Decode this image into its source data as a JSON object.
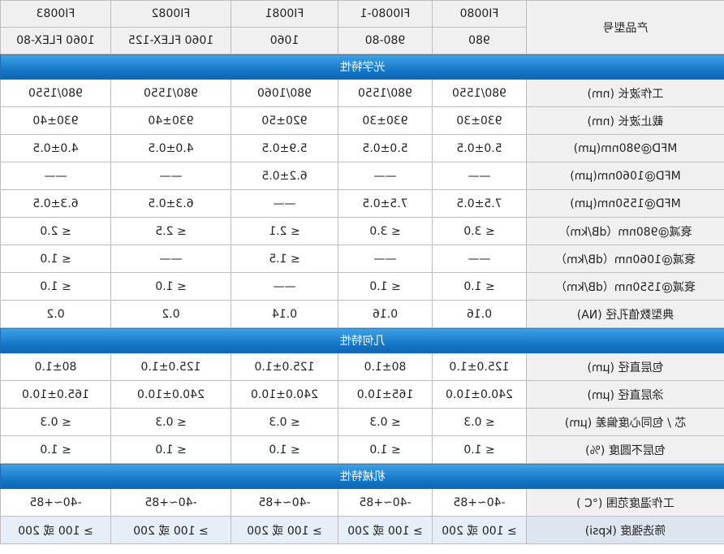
{
  "header": {
    "label": "产品型号",
    "models": [
      "FI0080",
      "FI0080-1",
      "FI0081",
      "FI0082",
      "FI0083"
    ],
    "types": [
      "980",
      "980-80",
      "1060",
      "1060 FLEX-125",
      "1060 FLEX-80"
    ]
  },
  "sections": [
    {
      "title": "光学特性",
      "rows": [
        {
          "label": "工作波长 (nm)",
          "values": [
            "980/1550",
            "980/1550",
            "980/1060",
            "980/1550",
            "980/1550"
          ]
        },
        {
          "label": "截止波长 (nm)",
          "values": [
            "930±30",
            "930±30",
            "920±50",
            "930±40",
            "930±40"
          ]
        },
        {
          "label": "MFD@980nm(μm)",
          "values": [
            "5.0±0.5",
            "5.0±0.5",
            "5.9±0.5",
            "4.0±0.5",
            "4.0±0.5"
          ]
        },
        {
          "label": "MFD@1060nm(μm)",
          "values": [
            "——",
            "——",
            "6.2±0.5",
            "——",
            "——"
          ]
        },
        {
          "label": "MFD@1550nm(μm)",
          "values": [
            "7.5±0.5",
            "7.5±0.5",
            "——",
            "6.3±0.5",
            "6.3±0.5"
          ]
        },
        {
          "label": "衰减@980nm（dB/km）",
          "values": [
            "≤ 3.0",
            "≤ 3.0",
            "≤ 2.1",
            "≤ 2.5",
            "≤ 2.0"
          ]
        },
        {
          "label": "衰减@1060nm（dB/km）",
          "values": [
            "——",
            "——",
            "≤ 1.5",
            "——",
            "≤ 1.0"
          ]
        },
        {
          "label": "衰减@1550nm（dB/km）",
          "values": [
            "≤ 1.0",
            "≤ 1.0",
            "——",
            "≤ 1.0",
            "≤ 1.0"
          ]
        },
        {
          "label": "典型数值孔径 (NA)",
          "values": [
            "0.16",
            "0.16",
            "0.14",
            "0.2",
            "0.2"
          ]
        }
      ]
    },
    {
      "title": "几何特性",
      "rows": [
        {
          "label": "包层直径 (μm)",
          "values": [
            "125.0±1.0",
            "80±1.0",
            "125.0±1.0",
            "125.0±1.0",
            "80±1.0"
          ]
        },
        {
          "label": "涂层直径 (μm)",
          "values": [
            "240.0±10.0",
            "165±10.0",
            "240.0±10.0",
            "240.0±10.0",
            "165.0±10.0"
          ]
        },
        {
          "label": "芯 / 包同心度偏差 (μm)",
          "values": [
            "≤ 0.3",
            "≤ 0.3",
            "≤ 0.3",
            "≤ 0.3",
            "≤ 0.3"
          ]
        },
        {
          "label": "包层不圆度 (%)",
          "values": [
            "≤ 1.0",
            "≤ 1.0",
            "≤ 1.0",
            "≤ 1.0",
            "≤ 1.0"
          ]
        }
      ]
    },
    {
      "title": "机械特性",
      "rows": [
        {
          "label": "工作温度范围 (°C )",
          "values": [
            "-40~+85",
            "-40~+85",
            "-40~+85",
            "-40~+85",
            "-40~+85"
          ]
        },
        {
          "label": "筛选强度 (kpsi)",
          "values": [
            "≥ 100 或 200",
            "≥ 100 或 200",
            "≥ 100 或 200",
            "≥ 100 或 200",
            "≥ 100 或 200"
          ]
        }
      ]
    }
  ]
}
